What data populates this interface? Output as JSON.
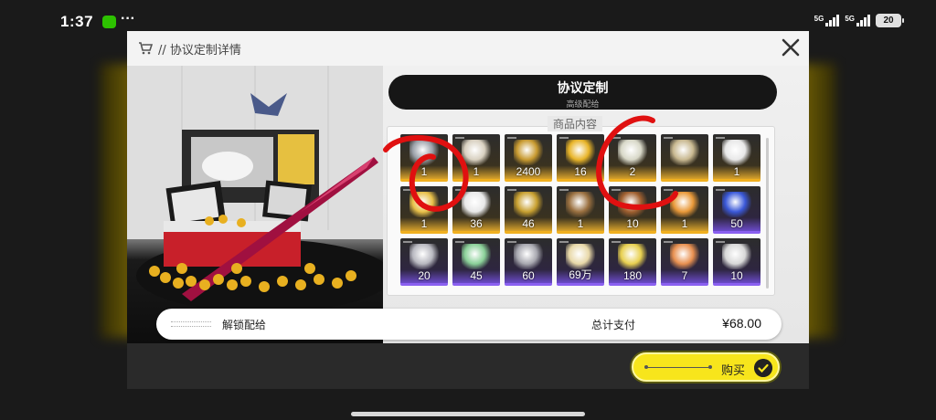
{
  "status_bar": {
    "time": "1:37",
    "network": "5G",
    "battery": "20"
  },
  "header": {
    "title": "// 协议定制详情"
  },
  "pack": {
    "name": "协议定制",
    "subtitle": "高级配给"
  },
  "contents_label": "商品内容",
  "items": [
    {
      "qty": "1",
      "rarity": "gold",
      "color": "#9aa0a8"
    },
    {
      "qty": "1",
      "rarity": "gold",
      "color": "#d8d0c0"
    },
    {
      "qty": "2400",
      "rarity": "gold",
      "color": "#c89a30"
    },
    {
      "qty": "16",
      "rarity": "gold",
      "color": "#e8b428"
    },
    {
      "qty": "2",
      "rarity": "gold",
      "color": "#d8d8c8"
    },
    {
      "qty": "",
      "rarity": "gold",
      "color": "#c8b890"
    },
    {
      "qty": "1",
      "rarity": "gold",
      "color": "#e8e8e8"
    },
    {
      "qty": "1",
      "rarity": "gold",
      "color": "#e8c048"
    },
    {
      "qty": "36",
      "rarity": "gold",
      "color": "#e8e8e8"
    },
    {
      "qty": "46",
      "rarity": "gold",
      "color": "#c8a030"
    },
    {
      "qty": "1",
      "rarity": "gold",
      "color": "#9a7040"
    },
    {
      "qty": "10",
      "rarity": "gold",
      "color": "#a06030"
    },
    {
      "qty": "1",
      "rarity": "gold",
      "color": "#e89838"
    },
    {
      "qty": "50",
      "rarity": "purple",
      "color": "#3a58d8"
    },
    {
      "qty": "20",
      "rarity": "purple",
      "color": "#b8b8c0"
    },
    {
      "qty": "45",
      "rarity": "purple",
      "color": "#8ad098"
    },
    {
      "qty": "60",
      "rarity": "purple",
      "color": "#a8a8b0"
    },
    {
      "qty": "69万",
      "rarity": "purple",
      "color": "#e8d8a8"
    },
    {
      "qty": "180",
      "rarity": "purple",
      "color": "#e8d050"
    },
    {
      "qty": "7",
      "rarity": "purple",
      "color": "#e89050"
    },
    {
      "qty": "10",
      "rarity": "purple",
      "color": "#d8d8d8"
    }
  ],
  "unlock": {
    "label": "解锁配给",
    "total_label": "总计支付",
    "price": "¥68.00"
  },
  "buy_button": {
    "label": "购买"
  },
  "colors": {
    "accent_yellow": "#f7e51c",
    "gold_tier": "#f0b020",
    "purple_tier": "#8a60f0",
    "annotation_red": "#e01010"
  }
}
